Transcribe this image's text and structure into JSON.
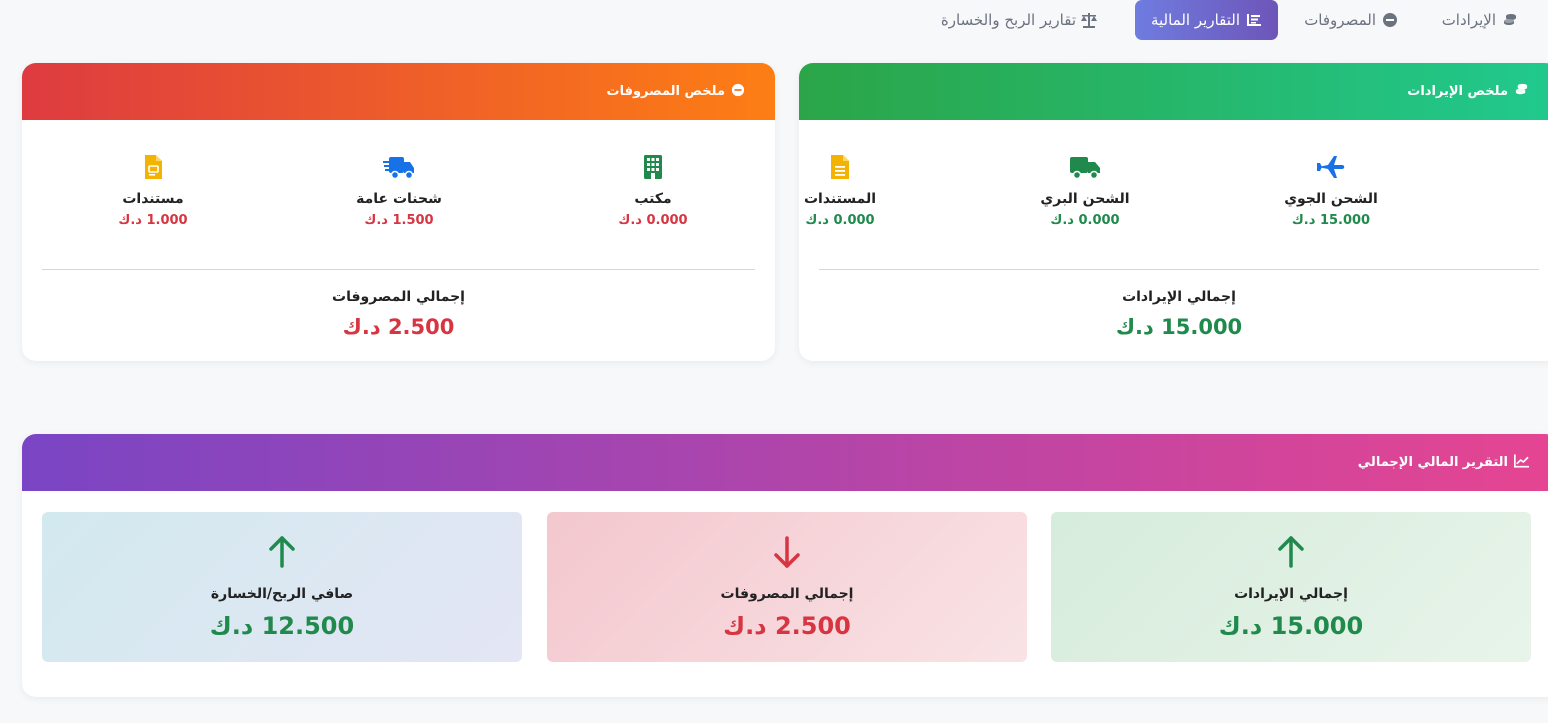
{
  "tabs": [
    {
      "label": "الإيرادات",
      "icon": "coins-icon"
    },
    {
      "label": "المصروفات",
      "icon": "minus-circle-icon"
    },
    {
      "label": "التقارير المالية",
      "icon": "report-list-icon",
      "active": true
    },
    {
      "label": "تقارير الربح والخسارة",
      "icon": "scale-icon"
    }
  ],
  "revenue_summary": {
    "title": "ملخص الإيرادات",
    "items": [
      {
        "label": "الشحن الجوي",
        "value": "15.000 د.ك",
        "icon": "plane-icon"
      },
      {
        "label": "الشحن البري",
        "value": "0.000 د.ك",
        "icon": "truck-icon"
      },
      {
        "label": "المستندات",
        "value": "0.000 د.ك",
        "icon": "document-icon"
      }
    ],
    "total_label": "إجمالي الإيرادات",
    "total_value": "15.000 د.ك"
  },
  "expense_summary": {
    "title": "ملخص المصروفات",
    "items": [
      {
        "label": "مكتب",
        "value": "0.000 د.ك",
        "icon": "building-icon"
      },
      {
        "label": "شحنات عامة",
        "value": "1.500 د.ك",
        "icon": "fast-truck-icon"
      },
      {
        "label": "مستندات",
        "value": "1.000 د.ك",
        "icon": "file-icon"
      }
    ],
    "total_label": "إجمالي المصروفات",
    "total_value": "2.500 د.ك"
  },
  "overall_report": {
    "title": "التقرير المالي الإجمالي",
    "boxes": [
      {
        "label": "إجمالي الإيرادات",
        "value": "15.000 د.ك",
        "icon": "arrow-up-icon"
      },
      {
        "label": "إجمالي المصروفات",
        "value": "2.500 د.ك",
        "icon": "arrow-down-icon"
      },
      {
        "label": "صافي الربح/الخسارة",
        "value": "12.500 د.ك",
        "icon": "arrow-up-icon"
      }
    ]
  },
  "colors": {
    "green": "#1f8a4c",
    "red": "#d63541",
    "blue": "#1672e6",
    "yellow": "#f5b301"
  }
}
